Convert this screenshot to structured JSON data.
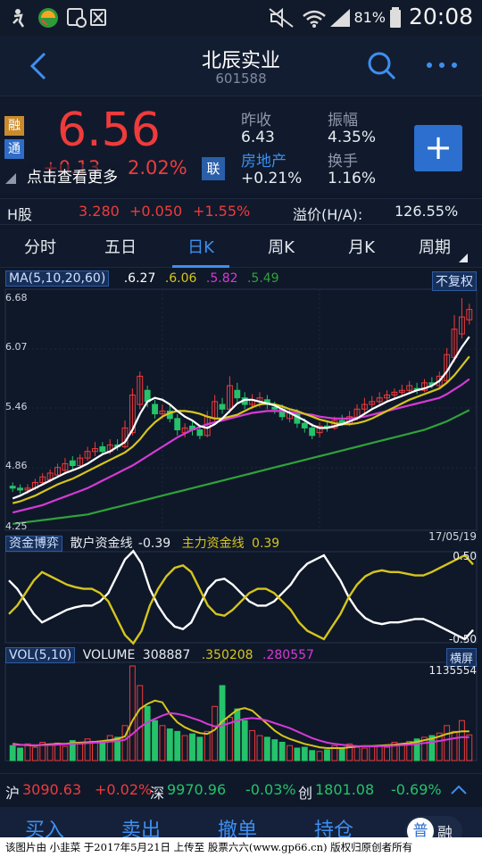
{
  "status_bar": {
    "battery": "81%",
    "time": "20:08"
  },
  "header": {
    "title": "北辰实业",
    "code": "601588"
  },
  "quote": {
    "price": "6.56",
    "change_partial": "+0.13",
    "change_pct": "2.02%",
    "tip": "点击查看更多",
    "tag_rong": "融",
    "tag_tong": "通",
    "tag_lian": "联",
    "prev_close_label": "昨收",
    "prev_close": "6.43",
    "amplitude_label": "振幅",
    "amplitude": "4.35%",
    "sector_label": "房地产",
    "sector_change": "+0.21%",
    "turnover_label": "换手",
    "turnover": "1.16%",
    "add_label": "+"
  },
  "hshare": {
    "label": "H股",
    "price": "3.280",
    "change": "+0.050",
    "change_pct": "+1.55%",
    "premium_label": "溢价(H/A):",
    "premium": "126.55%"
  },
  "tabs": [
    "分时",
    "五日",
    "日K",
    "周K",
    "月K",
    "周期"
  ],
  "ma_legend": {
    "label": "MA(5,10,20,60)",
    "ma5": ".6.27",
    "ma10": ".6.06",
    "ma20": ".5.82",
    "ma60": ".5.49",
    "adjust_button": "不复权"
  },
  "price_axis": [
    "6.68",
    "6.07",
    "5.46",
    "4.86",
    "4.25"
  ],
  "date_label": "17/05/19",
  "fund_legend": {
    "label": "资金博弈",
    "retail_label": "散户资金线",
    "retail_value": "-0.39",
    "main_label": "主力资金线",
    "main_value": "0.39",
    "top": "0.50",
    "bottom": "-0.50"
  },
  "vol_legend": {
    "label": "VOL(5,10)",
    "volume_label": "VOLUME",
    "volume": "308887",
    "v5": ".350208",
    "v10": ".280557",
    "landscape_button": "横屏",
    "max": "1135554"
  },
  "index_bar": {
    "sh_label": "沪",
    "sh_value": "3090.63",
    "sh_change": "+0.02%",
    "sz_label": "深",
    "sz_value": "9970.96",
    "sz_change": "-0.03%",
    "cy_label": "创",
    "cy_value": "1801.08",
    "cy_change": "-0.69%"
  },
  "bottom_bar": {
    "buy": "买入",
    "sell": "卖出",
    "cancel": "撤单",
    "position": "持仓",
    "mode_a": "普",
    "mode_b": "融"
  },
  "caption": "该图片由 小韭菜 于2017年5月21日 上传至 股票六六(www.gp66.cn) 版权归原创者所有",
  "colors": {
    "up": "#ef3b3b",
    "down": "#25c26a",
    "accent": "#3d8ff0",
    "ma5": "#ffffff",
    "ma10": "#d6c51c",
    "ma20": "#d63ad6",
    "ma60": "#2fa23a",
    "background": "#0f1829"
  },
  "chart_data": [
    {
      "type": "candlestick",
      "title": "日K",
      "ylim": [
        4.25,
        6.68
      ],
      "open": [
        4.68,
        4.66,
        4.64,
        4.66,
        4.72,
        4.75,
        4.8,
        4.85,
        4.95,
        4.9,
        4.98,
        5.05,
        5.1,
        5.05,
        5.12,
        5.1,
        5.25,
        5.55,
        5.7,
        5.55,
        5.45,
        5.48,
        5.4,
        5.25,
        5.32,
        5.28,
        5.22,
        5.4,
        5.55,
        5.5,
        5.7,
        5.62,
        5.55,
        5.58,
        5.6,
        5.52,
        5.5,
        5.4,
        5.45,
        5.35,
        5.3,
        5.25,
        5.32,
        5.3,
        5.38,
        5.35,
        5.4,
        5.5,
        5.55,
        5.58,
        5.62,
        5.65,
        5.68,
        5.7,
        5.72,
        5.7,
        5.78,
        5.75,
        5.8,
        6.05,
        6.3,
        6.45
      ],
      "close": [
        4.66,
        4.64,
        4.66,
        4.72,
        4.78,
        4.82,
        4.88,
        4.92,
        4.9,
        4.98,
        5.05,
        5.08,
        5.05,
        5.12,
        5.1,
        5.3,
        5.65,
        5.85,
        5.58,
        5.45,
        5.48,
        5.4,
        5.28,
        5.3,
        5.28,
        5.22,
        5.42,
        5.58,
        5.5,
        5.75,
        5.62,
        5.55,
        5.6,
        5.62,
        5.55,
        5.5,
        5.42,
        5.46,
        5.35,
        5.3,
        5.22,
        5.32,
        5.3,
        5.38,
        5.35,
        5.42,
        5.5,
        5.55,
        5.58,
        5.62,
        5.65,
        5.68,
        5.7,
        5.75,
        5.7,
        5.78,
        5.76,
        5.85,
        6.08,
        6.35,
        6.48,
        6.56
      ],
      "high": [
        4.72,
        4.7,
        4.7,
        4.76,
        4.82,
        4.86,
        4.92,
        4.98,
        5.0,
        5.02,
        5.1,
        5.15,
        5.15,
        5.18,
        5.18,
        5.38,
        5.72,
        5.9,
        5.75,
        5.6,
        5.55,
        5.55,
        5.45,
        5.35,
        5.38,
        5.32,
        5.48,
        5.65,
        5.62,
        5.85,
        5.78,
        5.68,
        5.66,
        5.68,
        5.65,
        5.58,
        5.55,
        5.5,
        5.5,
        5.4,
        5.35,
        5.36,
        5.38,
        5.42,
        5.44,
        5.48,
        5.55,
        5.62,
        5.64,
        5.68,
        5.7,
        5.72,
        5.76,
        5.8,
        5.78,
        5.82,
        5.84,
        5.9,
        6.15,
        6.5,
        6.68,
        6.62
      ],
      "low": [
        4.62,
        4.6,
        4.6,
        4.64,
        4.7,
        4.72,
        4.78,
        4.82,
        4.86,
        4.88,
        4.95,
        5.0,
        5.02,
        5.02,
        5.06,
        5.08,
        5.22,
        5.5,
        5.52,
        5.4,
        5.4,
        5.36,
        5.22,
        5.2,
        5.22,
        5.18,
        5.2,
        5.36,
        5.45,
        5.46,
        5.55,
        5.5,
        5.5,
        5.52,
        5.5,
        5.45,
        5.38,
        5.36,
        5.3,
        5.25,
        5.18,
        5.2,
        5.26,
        5.28,
        5.32,
        5.32,
        5.38,
        5.46,
        5.5,
        5.54,
        5.58,
        5.6,
        5.64,
        5.66,
        5.66,
        5.68,
        5.72,
        5.72,
        5.78,
        6.0,
        6.25,
        6.4
      ],
      "ma5": [
        4.55,
        4.58,
        4.62,
        4.66,
        4.7,
        4.74,
        4.78,
        4.82,
        4.85,
        4.88,
        4.92,
        4.97,
        5.02,
        5.05,
        5.1,
        5.15,
        5.28,
        5.45,
        5.58,
        5.62,
        5.6,
        5.55,
        5.48,
        5.42,
        5.38,
        5.32,
        5.3,
        5.34,
        5.4,
        5.48,
        5.56,
        5.6,
        5.6,
        5.58,
        5.56,
        5.54,
        5.5,
        5.46,
        5.42,
        5.38,
        5.33,
        5.3,
        5.3,
        5.32,
        5.34,
        5.37,
        5.4,
        5.45,
        5.5,
        5.54,
        5.58,
        5.61,
        5.64,
        5.67,
        5.7,
        5.72,
        5.75,
        5.8,
        5.9,
        6.03,
        6.16,
        6.27
      ],
      "ma10": [
        4.5,
        4.52,
        4.55,
        4.58,
        4.62,
        4.66,
        4.7,
        4.73,
        4.76,
        4.8,
        4.84,
        4.88,
        4.92,
        4.96,
        5.0,
        5.04,
        5.1,
        5.18,
        5.28,
        5.36,
        5.42,
        5.46,
        5.48,
        5.48,
        5.47,
        5.45,
        5.42,
        5.4,
        5.4,
        5.42,
        5.44,
        5.48,
        5.52,
        5.55,
        5.56,
        5.55,
        5.53,
        5.5,
        5.48,
        5.45,
        5.42,
        5.39,
        5.37,
        5.35,
        5.34,
        5.34,
        5.35,
        5.37,
        5.4,
        5.44,
        5.48,
        5.52,
        5.56,
        5.6,
        5.63,
        5.66,
        5.69,
        5.72,
        5.78,
        5.86,
        5.96,
        6.06
      ],
      "ma20": [
        4.4,
        4.42,
        4.44,
        4.46,
        4.48,
        4.51,
        4.54,
        4.57,
        4.6,
        4.63,
        4.66,
        4.7,
        4.74,
        4.78,
        4.82,
        4.86,
        4.9,
        4.95,
        5.0,
        5.05,
        5.1,
        5.15,
        5.2,
        5.24,
        5.28,
        5.31,
        5.34,
        5.36,
        5.38,
        5.4,
        5.42,
        5.44,
        5.46,
        5.47,
        5.48,
        5.48,
        5.48,
        5.47,
        5.46,
        5.45,
        5.44,
        5.42,
        5.41,
        5.4,
        5.4,
        5.4,
        5.41,
        5.42,
        5.44,
        5.46,
        5.48,
        5.5,
        5.52,
        5.54,
        5.56,
        5.58,
        5.6,
        5.62,
        5.66,
        5.71,
        5.76,
        5.82
      ],
      "ma60": [
        4.28,
        4.29,
        4.3,
        4.31,
        4.32,
        4.33,
        4.34,
        4.35,
        4.36,
        4.37,
        4.38,
        4.4,
        4.42,
        4.44,
        4.46,
        4.48,
        4.5,
        4.52,
        4.54,
        4.56,
        4.58,
        4.6,
        4.62,
        4.64,
        4.66,
        4.68,
        4.7,
        4.72,
        4.74,
        4.76,
        4.78,
        4.8,
        4.82,
        4.84,
        4.86,
        4.88,
        4.9,
        4.92,
        4.94,
        4.96,
        4.98,
        5.0,
        5.02,
        5.04,
        5.06,
        5.08,
        5.1,
        5.12,
        5.14,
        5.16,
        5.18,
        5.2,
        5.22,
        5.24,
        5.26,
        5.28,
        5.31,
        5.34,
        5.37,
        5.41,
        5.45,
        5.49
      ]
    },
    {
      "type": "line",
      "title": "资金博弈",
      "ylim": [
        -0.5,
        0.5
      ],
      "series": [
        {
          "name": "散户资金线",
          "values": [
            0.2,
            0.1,
            -0.05,
            -0.2,
            -0.3,
            -0.25,
            -0.2,
            -0.15,
            -0.12,
            -0.1,
            -0.1,
            -0.05,
            0.05,
            0.25,
            0.45,
            0.55,
            0.4,
            0.1,
            -0.1,
            -0.25,
            -0.35,
            -0.38,
            -0.3,
            -0.1,
            0.1,
            0.2,
            0.22,
            0.15,
            0.05,
            -0.05,
            -0.1,
            -0.1,
            -0.05,
            0.05,
            0.15,
            0.3,
            0.4,
            0.45,
            0.5,
            0.35,
            0.2,
            0.0,
            -0.15,
            -0.25,
            -0.3,
            -0.32,
            -0.3,
            -0.3,
            -0.28,
            -0.26,
            -0.26,
            -0.3,
            -0.35,
            -0.4,
            -0.45,
            -0.5,
            -0.39
          ]
        },
        {
          "name": "主力资金线",
          "values": [
            -0.2,
            -0.1,
            0.05,
            0.2,
            0.3,
            0.25,
            0.2,
            0.15,
            0.12,
            0.1,
            0.1,
            0.05,
            -0.05,
            -0.25,
            -0.45,
            -0.55,
            -0.4,
            -0.1,
            0.1,
            0.25,
            0.35,
            0.38,
            0.3,
            0.1,
            -0.1,
            -0.2,
            -0.22,
            -0.15,
            -0.05,
            0.05,
            0.1,
            0.1,
            0.05,
            -0.05,
            -0.15,
            -0.3,
            -0.4,
            -0.45,
            -0.5,
            -0.35,
            -0.2,
            0.0,
            0.15,
            0.25,
            0.3,
            0.32,
            0.3,
            0.3,
            0.28,
            0.26,
            0.26,
            0.3,
            0.35,
            0.4,
            0.45,
            0.5,
            0.39
          ]
        }
      ]
    },
    {
      "type": "bar",
      "title": "VOL(5,10)",
      "ylim": [
        0,
        1135554
      ],
      "values": [
        180000,
        150000,
        200000,
        160000,
        220000,
        190000,
        210000,
        170000,
        240000,
        200000,
        260000,
        230000,
        220000,
        300000,
        280000,
        420000,
        1135554,
        900000,
        650000,
        480000,
        420000,
        380000,
        350000,
        300000,
        320000,
        280000,
        350000,
        650000,
        900000,
        520000,
        620000,
        480000,
        360000,
        300000,
        280000,
        250000,
        220000,
        180000,
        150000,
        160000,
        120000,
        110000,
        130000,
        180000,
        140000,
        200000,
        160000,
        150000,
        170000,
        180000,
        160000,
        220000,
        200000,
        230000,
        260000,
        280000,
        300000,
        330000,
        420000,
        350000,
        480000,
        308887
      ],
      "up": [
        false,
        false,
        true,
        true,
        true,
        true,
        true,
        true,
        false,
        true,
        true,
        true,
        false,
        true,
        false,
        true,
        true,
        true,
        false,
        false,
        true,
        false,
        false,
        true,
        false,
        false,
        true,
        true,
        false,
        true,
        false,
        false,
        true,
        true,
        false,
        false,
        false,
        true,
        false,
        false,
        false,
        true,
        false,
        true,
        false,
        true,
        true,
        true,
        true,
        true,
        true,
        true,
        true,
        true,
        false,
        true,
        false,
        true,
        true,
        true,
        true,
        true
      ],
      "ma5": [
        200000,
        190000,
        185000,
        180000,
        190000,
        195000,
        200000,
        200000,
        210000,
        215000,
        220000,
        225000,
        235000,
        245000,
        260000,
        290000,
        480000,
        620000,
        680000,
        720000,
        700000,
        560000,
        460000,
        400000,
        360000,
        330000,
        320000,
        370000,
        470000,
        540000,
        610000,
        630000,
        600000,
        520000,
        440000,
        360000,
        300000,
        260000,
        230000,
        200000,
        180000,
        160000,
        150000,
        150000,
        150000,
        160000,
        170000,
        175000,
        175000,
        180000,
        185000,
        190000,
        200000,
        210000,
        225000,
        245000,
        265000,
        290000,
        320000,
        340000,
        350208,
        350208
      ],
      "ma10": [
        190000,
        188000,
        186000,
        184000,
        186000,
        188000,
        192000,
        195000,
        200000,
        205000,
        210000,
        215000,
        220000,
        228000,
        235000,
        250000,
        320000,
        400000,
        460000,
        500000,
        540000,
        570000,
        560000,
        540000,
        510000,
        480000,
        440000,
        410000,
        420000,
        450000,
        480000,
        500000,
        510000,
        500000,
        480000,
        450000,
        420000,
        390000,
        350000,
        310000,
        270000,
        240000,
        215000,
        200000,
        190000,
        180000,
        175000,
        172000,
        170000,
        172000,
        175000,
        180000,
        186000,
        192000,
        200000,
        210000,
        222000,
        236000,
        252000,
        268000,
        280557,
        280557
      ]
    }
  ]
}
